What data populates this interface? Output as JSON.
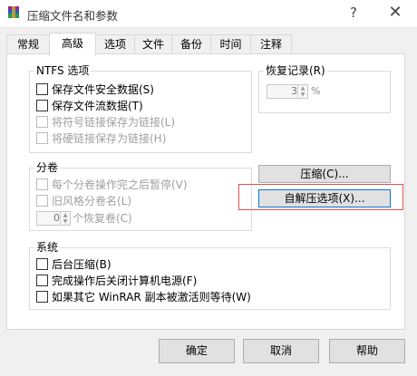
{
  "window": {
    "title": "压缩文件名和参数",
    "help": "?",
    "close": "✕"
  },
  "tabs": [
    "常规",
    "高级",
    "选项",
    "文件",
    "备份",
    "时间",
    "注释"
  ],
  "ntfs": {
    "title": "NTFS 选项",
    "items": [
      {
        "label": "保存文件安全数据(S)",
        "checked": false,
        "enabled": true
      },
      {
        "label": "保存文件流数据(T)",
        "checked": false,
        "enabled": true
      },
      {
        "label": "将符号链接保存为链接(L)",
        "checked": false,
        "enabled": false
      },
      {
        "label": "将硬链接保存为链接(H)",
        "checked": false,
        "enabled": false
      }
    ]
  },
  "recovery": {
    "title": "恢复记录(R)",
    "value": "3",
    "unit": "%"
  },
  "volumes": {
    "title": "分卷",
    "items": [
      {
        "label": "每个分卷操作完之后暂停(V)",
        "enabled": false
      },
      {
        "label": "旧风格分卷名(L)",
        "enabled": false
      }
    ],
    "spin_value": "0",
    "spin_label": "个恢复卷(C)"
  },
  "buttons": {
    "compress": "压缩(C)...",
    "sfx": "自解压选项(X)..."
  },
  "system": {
    "title": "系统",
    "items": [
      {
        "label": "后台压缩(B)"
      },
      {
        "label": "完成操作后关闭计算机电源(F)"
      },
      {
        "label": "如果其它 WinRAR 副本被激活则等待(W)"
      }
    ]
  },
  "footer": {
    "ok": "确定",
    "cancel": "取消",
    "help": "帮助"
  }
}
